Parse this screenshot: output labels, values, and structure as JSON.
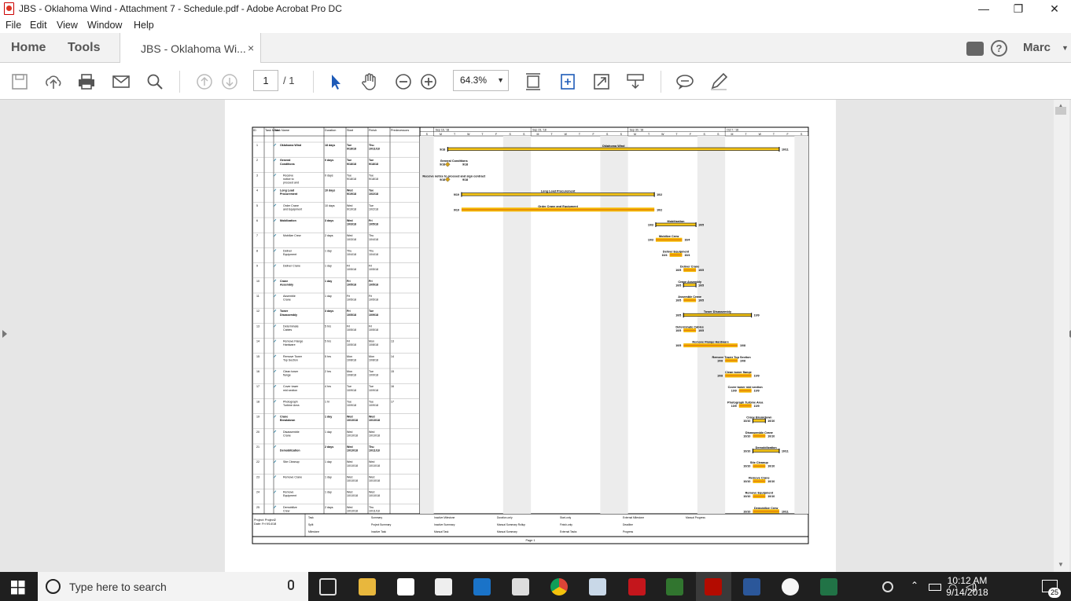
{
  "window": {
    "title": "JBS - Oklahoma Wind - Attachment 7 - Schedule.pdf - Adobe Acrobat Pro DC",
    "minimize": "—",
    "maximize": "❐",
    "close": "✕"
  },
  "menu": [
    "File",
    "Edit",
    "View",
    "Window",
    "Help"
  ],
  "tabs": {
    "home": "Home",
    "tools": "Tools",
    "document": "JBS - Oklahoma Wi...",
    "close": "×"
  },
  "account": {
    "user": "Marc"
  },
  "toolbar": {
    "page_current": "1",
    "page_total": "/ 1",
    "zoom": "64.3%",
    "icons": [
      "save-icon",
      "cloud-upload-icon",
      "print-icon",
      "email-icon",
      "search-icon",
      "page-up-icon",
      "page-down-icon",
      "zoom-out-icon",
      "zoom-in-icon",
      "select-arrow-icon",
      "hand-icon",
      "fit-page-icon",
      "rotate-icon",
      "fullscreen-icon",
      "scroll-mode-icon",
      "comment-icon",
      "pen-icon"
    ]
  },
  "gantt": {
    "headers": [
      "ID",
      "Task Mode",
      "Task Name",
      "Duration",
      "Start",
      "Finish",
      "Predecessors"
    ],
    "timescale": [
      "Sep 16, '18",
      "Sep 23, '18",
      "Sep 30, '18",
      "Oct 7, '18"
    ],
    "days": [
      "S",
      "M",
      "T",
      "W",
      "T",
      "F",
      "S",
      "S",
      "M",
      "T",
      "W",
      "T",
      "F",
      "S",
      "S",
      "M",
      "T",
      "W",
      "T",
      "F",
      "S",
      "S",
      "M",
      "T",
      "W",
      "T",
      "F",
      "S"
    ],
    "tasks": [
      {
        "id": "1",
        "name": "Oklahoma Wind",
        "dur": "18 days",
        "start": "Tue 9/18/18",
        "finish": "Thu 10/11/18",
        "pred": "",
        "summary": true,
        "bar": "Oklahoma Wind",
        "s": "9/18",
        "f": "10/11"
      },
      {
        "id": "2",
        "name": "General Conditions",
        "dur": "0 days",
        "start": "Tue 9/18/18",
        "finish": "Tue 9/18/18",
        "pred": "",
        "summary": true,
        "bar": "General Conditions",
        "s": "9/18",
        "f": "9/18"
      },
      {
        "id": "3",
        "name": "Receive notice to proceed and sign contract",
        "dur": "0 days",
        "start": "Tue 9/18/18",
        "finish": "Tue 9/18/18",
        "pred": "",
        "bar": "Receive notice to proceed and sign contract",
        "s": "9/18",
        "f": "9/18"
      },
      {
        "id": "4",
        "name": "Long Lead Procurement",
        "dur": "10 days",
        "start": "Wed 9/19/18",
        "finish": "Tue 10/2/18",
        "pred": "",
        "summary": true,
        "bar": "Long Lead Procurement",
        "s": "9/19",
        "f": "10/2"
      },
      {
        "id": "5",
        "name": "Order Crane and Equipment",
        "dur": "10 days",
        "start": "Wed 9/19/18",
        "finish": "Tue 10/2/18",
        "pred": "",
        "bar": "Order Crane and Equipment",
        "s": "9/19",
        "f": "10/2"
      },
      {
        "id": "6",
        "name": "Mobilization",
        "dur": "3 days",
        "start": "Wed 10/3/18",
        "finish": "Fri 10/5/18",
        "pred": "",
        "summary": true,
        "bar": "Mobilization",
        "s": "10/3",
        "f": "10/5"
      },
      {
        "id": "7",
        "name": "Mobilize Crew",
        "dur": "2 days",
        "start": "Wed 10/3/18",
        "finish": "Thu 10/4/18",
        "pred": "",
        "bar": "Mobilize Crew",
        "s": "10/3",
        "f": "10/4"
      },
      {
        "id": "8",
        "name": "Deliver Equipment",
        "dur": "1 day",
        "start": "Thu 10/4/18",
        "finish": "Thu 10/4/18",
        "pred": "",
        "bar": "Deliver Equipment",
        "s": "10/4",
        "f": "10/4"
      },
      {
        "id": "9",
        "name": "Deliver Crane",
        "dur": "1 day",
        "start": "Fri 10/5/18",
        "finish": "Fri 10/5/18",
        "pred": "",
        "bar": "Deliver Crane",
        "s": "10/5",
        "f": "10/5"
      },
      {
        "id": "10",
        "name": "Crane Assembly",
        "dur": "1 day",
        "start": "Fri 10/5/18",
        "finish": "Fri 10/5/18",
        "pred": "",
        "summary": true,
        "bar": "Crane Assembly",
        "s": "10/5",
        "f": "10/5"
      },
      {
        "id": "11",
        "name": "Assemble Crane",
        "dur": "1 day",
        "start": "Fri 10/5/18",
        "finish": "Fri 10/5/18",
        "pred": "",
        "bar": "Assemble Crane",
        "s": "10/5",
        "f": "10/5"
      },
      {
        "id": "12",
        "name": "Tower Disassembly",
        "dur": "3 days",
        "start": "Fri 10/5/18",
        "finish": "Tue 10/9/18",
        "pred": "",
        "summary": true,
        "bar": "Tower Disassembly",
        "s": "10/5",
        "f": "10/9"
      },
      {
        "id": "13",
        "name": "Determinate Cables",
        "dur": "5 hrs",
        "start": "Fri 10/5/18",
        "finish": "Fri 10/5/18",
        "pred": "",
        "bar": "Determinate Cables",
        "s": "10/5",
        "f": "10/5"
      },
      {
        "id": "14",
        "name": "Remove Flange Hardware",
        "dur": "5 hrs",
        "start": "Fri 10/5/18",
        "finish": "Mon 10/8/18",
        "pred": "13",
        "bar": "Remove Flange Hardware",
        "s": "10/5",
        "f": "10/8"
      },
      {
        "id": "15",
        "name": "Remove Tower Top Section",
        "dur": "5 hrs",
        "start": "Mon 10/8/18",
        "finish": "Mon 10/8/18",
        "pred": "14",
        "bar": "Remove Tower Top Section",
        "s": "10/8",
        "f": "10/8"
      },
      {
        "id": "16",
        "name": "Clean tower flange",
        "dur": "2 hrs",
        "start": "Mon 10/8/18",
        "finish": "Tue 10/9/18",
        "pred": "15",
        "bar": "Clean tower flange",
        "s": "10/8",
        "f": "10/9"
      },
      {
        "id": "17",
        "name": "Cover tower mid section",
        "dur": "4 hrs",
        "start": "Tue 10/9/18",
        "finish": "Tue 10/9/18",
        "pred": "16",
        "bar": "Cover tower mid section",
        "s": "10/9",
        "f": "10/9"
      },
      {
        "id": "18",
        "name": "Photograph Turbine Area",
        "dur": "1 hr",
        "start": "Tue 10/9/18",
        "finish": "Tue 10/9/18",
        "pred": "17",
        "bar": "Photograph Turbine Area",
        "s": "10/9",
        "f": "10/9"
      },
      {
        "id": "19",
        "name": "Crane Breakdown",
        "dur": "1 day",
        "start": "Wed 10/10/18",
        "finish": "Wed 10/10/18",
        "pred": "",
        "summary": true,
        "bar": "Crane Breakdown",
        "s": "10/10",
        "f": "10/10"
      },
      {
        "id": "20",
        "name": "Disassemble Crane",
        "dur": "1 day",
        "start": "Wed 10/10/18",
        "finish": "Wed 10/10/18",
        "pred": "",
        "bar": "Disassemble Crane",
        "s": "10/10",
        "f": "10/10"
      },
      {
        "id": "21",
        "name": "Demobilization",
        "dur": "2 days",
        "start": "Wed 10/10/18",
        "finish": "Thu 10/11/18",
        "pred": "",
        "summary": true,
        "bar": "Demobilization",
        "s": "10/10",
        "f": "10/11"
      },
      {
        "id": "22",
        "name": "Site Cleanup",
        "dur": "1 day",
        "start": "Wed 10/10/18",
        "finish": "Wed 10/10/18",
        "pred": "",
        "bar": "Site Cleanup",
        "s": "10/10",
        "f": "10/10"
      },
      {
        "id": "23",
        "name": "Remove Crane",
        "dur": "1 day",
        "start": "Wed 10/10/18",
        "finish": "Wed 10/10/18",
        "pred": "",
        "bar": "Remove Crane",
        "s": "10/10",
        "f": "10/10"
      },
      {
        "id": "24",
        "name": "Remove Equipment",
        "dur": "1 day",
        "start": "Wed 10/10/18",
        "finish": "Wed 10/10/18",
        "pred": "",
        "bar": "Remove Equipment",
        "s": "10/10",
        "f": "10/10"
      },
      {
        "id": "25",
        "name": "Demobilize Crew",
        "dur": "2 days",
        "start": "Wed 10/10/18",
        "finish": "Thu 10/11/18",
        "pred": "",
        "bar": "Demobilize Crew",
        "s": "10/10",
        "f": "10/11"
      }
    ],
    "legend": {
      "project": "Project: Project2",
      "date": "Date: Fri 9/14/18",
      "items": [
        "Task",
        "Split",
        "Milestone",
        "Summary",
        "Project Summary",
        "Inactive Task",
        "Inactive Milestone",
        "Inactive Summary",
        "Manual Task",
        "Duration-only",
        "Manual Summary Rollup",
        "Manual Summary",
        "Start-only",
        "Finish-only",
        "External Tasks",
        "External Milestone",
        "Deadline",
        "Progress",
        "Manual Progress"
      ]
    },
    "footer": "Page 1"
  },
  "taskbar": {
    "search_placeholder": "Type here to search",
    "time": "10:12 AM",
    "date": "9/14/2018",
    "notifications": "25"
  }
}
